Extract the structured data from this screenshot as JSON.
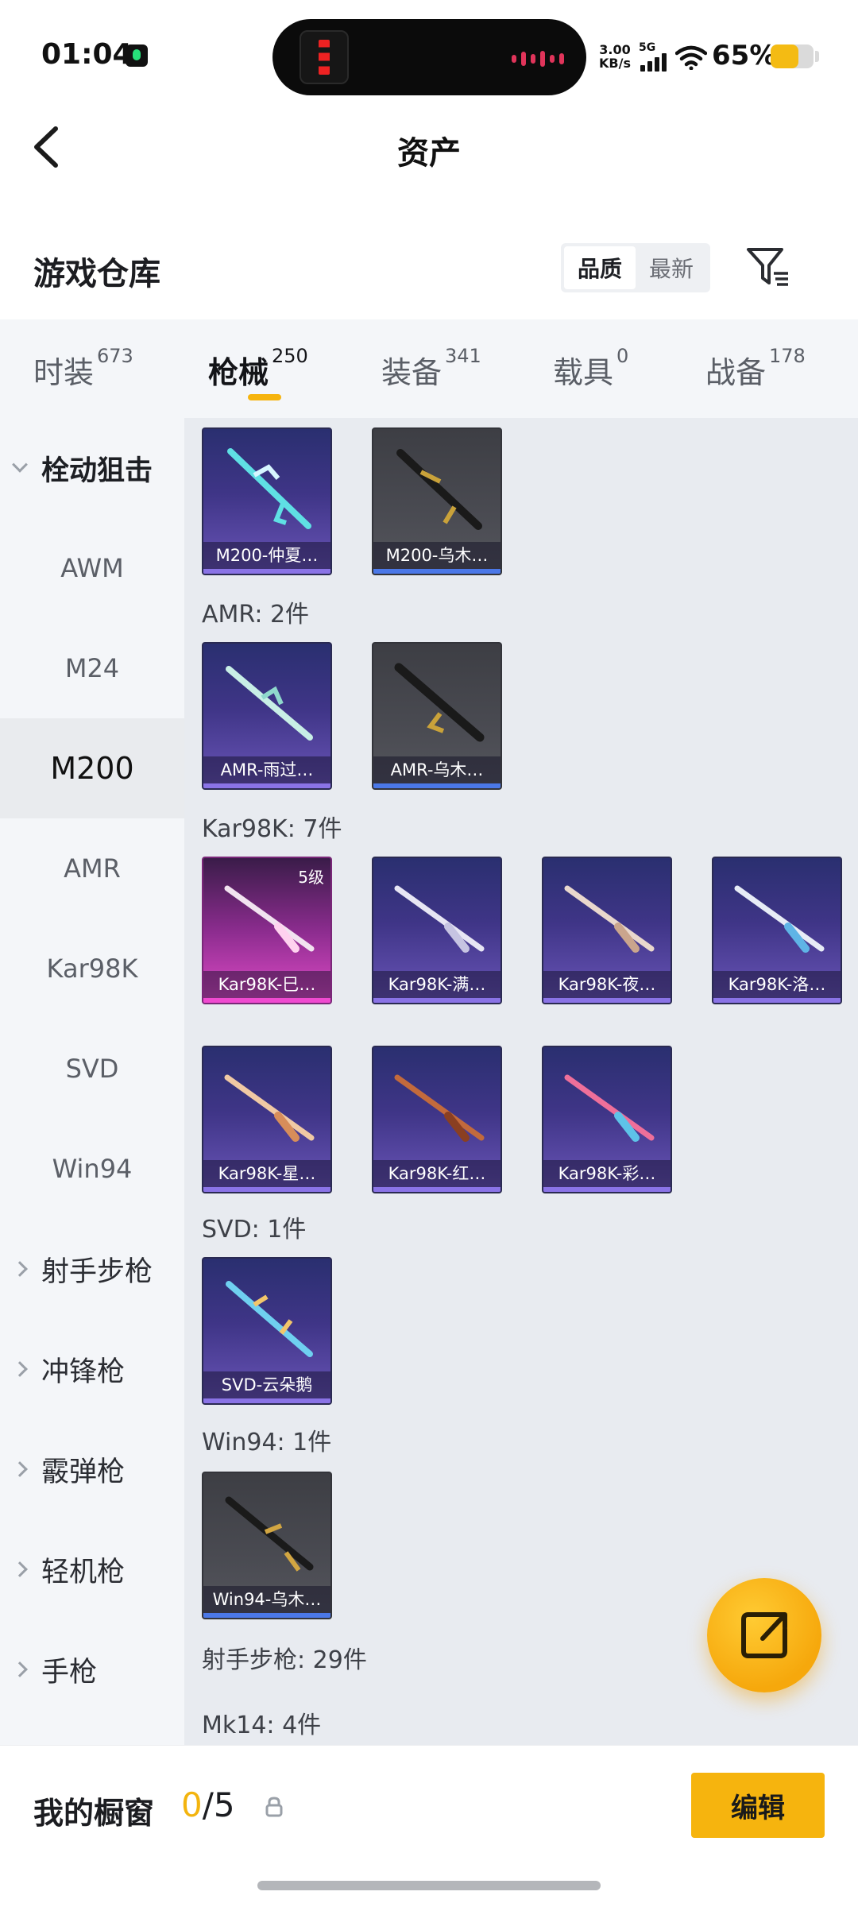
{
  "status_bar": {
    "time": "01:04",
    "net_speed_top": "3.00",
    "net_speed_unit": "KB/s",
    "network": "5G",
    "battery": "65%",
    "battery_level": 0.65
  },
  "header": {
    "title": "资产",
    "back_icon": "chevron-left-icon"
  },
  "section": {
    "title": "游戏仓库",
    "sort_options": [
      "品质",
      "最新"
    ],
    "sort_selected": "品质",
    "filter_icon": "filter-icon"
  },
  "tabs": [
    {
      "label": "时装",
      "count": "673"
    },
    {
      "label": "枪械",
      "count": "250",
      "active": true
    },
    {
      "label": "装备",
      "count": "341"
    },
    {
      "label": "载具",
      "count": "0"
    },
    {
      "label": "战备",
      "count": "178"
    }
  ],
  "sidebar": {
    "group_open": "栓动狙击",
    "sub_items": [
      "AWM",
      "M24",
      "M200",
      "AMR",
      "Kar98K",
      "SVD",
      "Win94"
    ],
    "selected": "M200",
    "groups_closed": [
      "射手步枪",
      "冲锋枪",
      "霰弹枪",
      "轻机枪",
      "手枪"
    ]
  },
  "content": {
    "m200_items": [
      "M200-仲夏…",
      "M200-乌木…"
    ],
    "amr_label": "AMR: 2件",
    "amr_items": [
      "AMR-雨过…",
      "AMR-乌木…"
    ],
    "kar_label": "Kar98K: 7件",
    "kar_items": [
      "Kar98K-巳…",
      "Kar98K-满…",
      "Kar98K-夜…",
      "Kar98K-洛…",
      "Kar98K-星…",
      "Kar98K-红…",
      "Kar98K-彩…"
    ],
    "kar_level": "5级",
    "svd_label": "SVD: 1件",
    "svd_items": [
      "SVD-云朵鹅"
    ],
    "win94_label": "Win94: 1件",
    "win94_items": [
      "Win94-乌木…"
    ],
    "dmr_label": "射手步枪: 29件",
    "mk14_label": "Mk14: 4件"
  },
  "fab": {
    "icon": "external-link-icon"
  },
  "bottom_bar": {
    "label": "我的橱窗",
    "count_current": "0",
    "count_total": "/5",
    "lock_icon": "lock-icon",
    "edit_label": "编辑"
  },
  "colors": {
    "accent": "#f6b40e",
    "card_purple": "#3f3587",
    "card_grey": "#4a4b52",
    "card_pink": "#e04bc7"
  }
}
